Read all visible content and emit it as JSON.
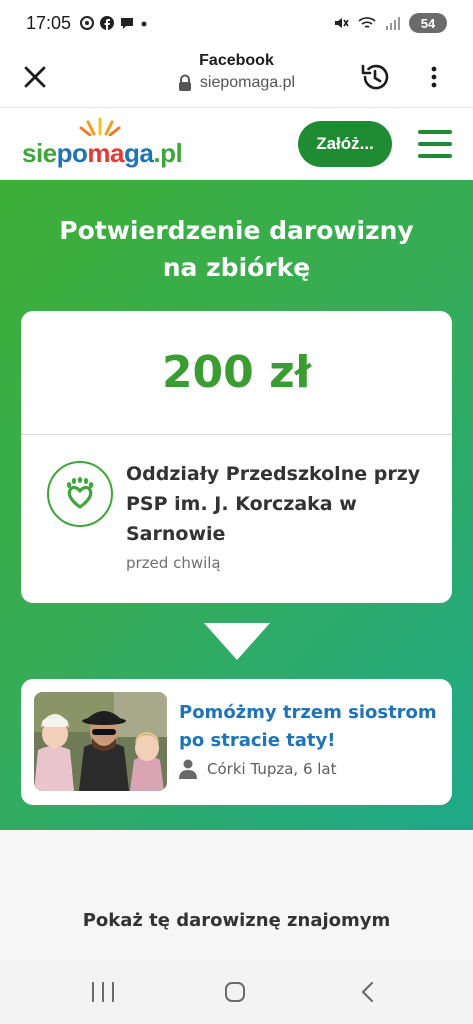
{
  "status_bar": {
    "time": "17:05",
    "notification_icons": [
      "threads-icon",
      "facebook-icon",
      "chat-icon",
      "dot-icon"
    ],
    "battery": "54"
  },
  "browser": {
    "title": "Facebook",
    "url": "siepomaga.pl"
  },
  "site": {
    "logo": {
      "sie": "sie",
      "po": "po",
      "ma": "ma",
      "ga": "ga",
      "pl": ".pl"
    },
    "cta_label": "Załóż...",
    "brand_green": "#1f8c34"
  },
  "hero": {
    "title_line1": "Potwierdzenie darowizny",
    "title_line2": "na zbiórkę"
  },
  "donation": {
    "amount": "200 zł",
    "org_name": "Oddziały Przedszkolne przy PSP im. J. Korczaka w Sarnowie",
    "time": "przed chwilą"
  },
  "campaign": {
    "title": "Pomóżmy trzem siostrom po stracie taty!",
    "meta": "Córki Tupza, 6 lat"
  },
  "share": {
    "title": "Pokaż tę darowiznę znajomym"
  }
}
